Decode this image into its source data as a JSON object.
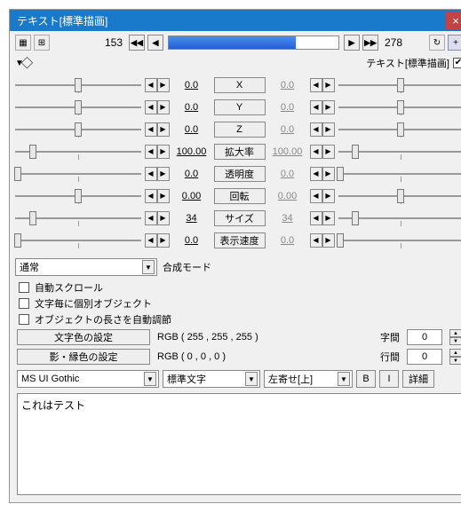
{
  "window": {
    "title": "テキスト[標準描画]"
  },
  "timeline": {
    "start": "153",
    "end": "278",
    "progress_pct": 75
  },
  "subheader": {
    "label": "テキスト[標準描画]",
    "checked": true
  },
  "params": [
    {
      "label": "X",
      "v1": "0.0",
      "v2": "0.0",
      "p1": 50,
      "p2": 50
    },
    {
      "label": "Y",
      "v1": "0.0",
      "v2": "0.0",
      "p1": 50,
      "p2": 50
    },
    {
      "label": "Z",
      "v1": "0.0",
      "v2": "0.0",
      "p1": 50,
      "p2": 50
    },
    {
      "label": "拡大率",
      "v1": "100.00",
      "v2": "100.00",
      "p1": 14,
      "p2": 14
    },
    {
      "label": "透明度",
      "v1": "0.0",
      "v2": "0.0",
      "p1": 2,
      "p2": 2
    },
    {
      "label": "回転",
      "v1": "0.00",
      "v2": "0.00",
      "p1": 50,
      "p2": 50
    },
    {
      "label": "サイズ",
      "v1": "34",
      "v2": "34",
      "p1": 14,
      "p2": 14
    },
    {
      "label": "表示速度",
      "v1": "0.0",
      "v2": "0.0",
      "p1": 2,
      "p2": 2
    }
  ],
  "blend": {
    "label": "合成モード",
    "value": "通常"
  },
  "checks": [
    {
      "label": "自動スクロール",
      "checked": false
    },
    {
      "label": "文字毎に個別オブジェクト",
      "checked": false
    },
    {
      "label": "オブジェクトの長さを自動調節",
      "checked": false
    }
  ],
  "color1": {
    "btn": "文字色の設定",
    "rgb": "RGB ( 255 , 255 , 255 )"
  },
  "color2": {
    "btn": "影・縁色の設定",
    "rgb": "RGB ( 0 , 0 , 0 )"
  },
  "spacing": {
    "char_label": "字間",
    "char_val": "0",
    "line_label": "行間",
    "line_val": "0"
  },
  "font": {
    "name": "MS UI Gothic",
    "weight": "標準文字",
    "align": "左寄せ[上]",
    "b": "B",
    "i": "I",
    "detail": "詳細"
  },
  "text": "これはテスト",
  "icons": {
    "close": "×",
    "left2": "◀◀",
    "left1": "◀",
    "right1": "▶",
    "right2": "▶▶",
    "down": "▼",
    "up": "▲",
    "tri_l": "◀",
    "tri_r": "▶",
    "check": "✔",
    "loop": "↻",
    "plus": "+",
    "cam1": "▦",
    "cam2": "⊞",
    "tri": "▼",
    "mouse": "⃟"
  }
}
